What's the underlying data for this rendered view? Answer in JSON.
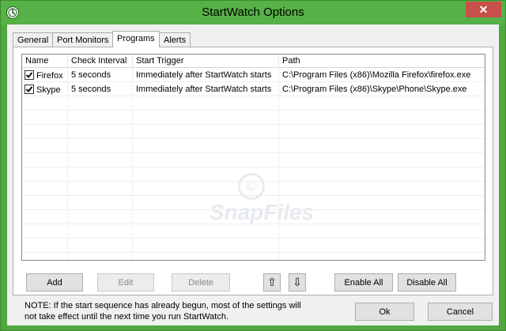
{
  "window": {
    "title": "StartWatch Options",
    "close_label": "✕"
  },
  "tabs": [
    {
      "label": "General"
    },
    {
      "label": "Port Monitors"
    },
    {
      "label": "Programs"
    },
    {
      "label": "Alerts"
    }
  ],
  "active_tab": "Programs",
  "table": {
    "columns": [
      "Name",
      "Check Interval",
      "Start Trigger",
      "Path"
    ],
    "rows": [
      {
        "checked": true,
        "name": "Firefox",
        "interval": "5 seconds",
        "trigger": "Immediately after StartWatch starts",
        "path": "C:\\Program Files (x86)\\Mozilla Firefox\\firefox.exe"
      },
      {
        "checked": true,
        "name": "Skype",
        "interval": "5 seconds",
        "trigger": "Immediately after StartWatch starts",
        "path": "C:\\Program Files (x86)\\Skype\\Phone\\Skype.exe"
      }
    ]
  },
  "buttons": {
    "add": "Add",
    "edit": "Edit",
    "delete": "Delete",
    "move_up": "⇧",
    "move_down": "⇩",
    "enable_all": "Enable All",
    "disable_all": "Disable All",
    "ok": "Ok",
    "cancel": "Cancel"
  },
  "note": "NOTE: If the start sequence has already begun, most of the settings will not take effect until the next time you run StartWatch.",
  "watermark": {
    "symbol": "©",
    "text": "SnapFiles"
  },
  "colors": {
    "titlebar": "#56b146",
    "close": "#c7504a"
  }
}
